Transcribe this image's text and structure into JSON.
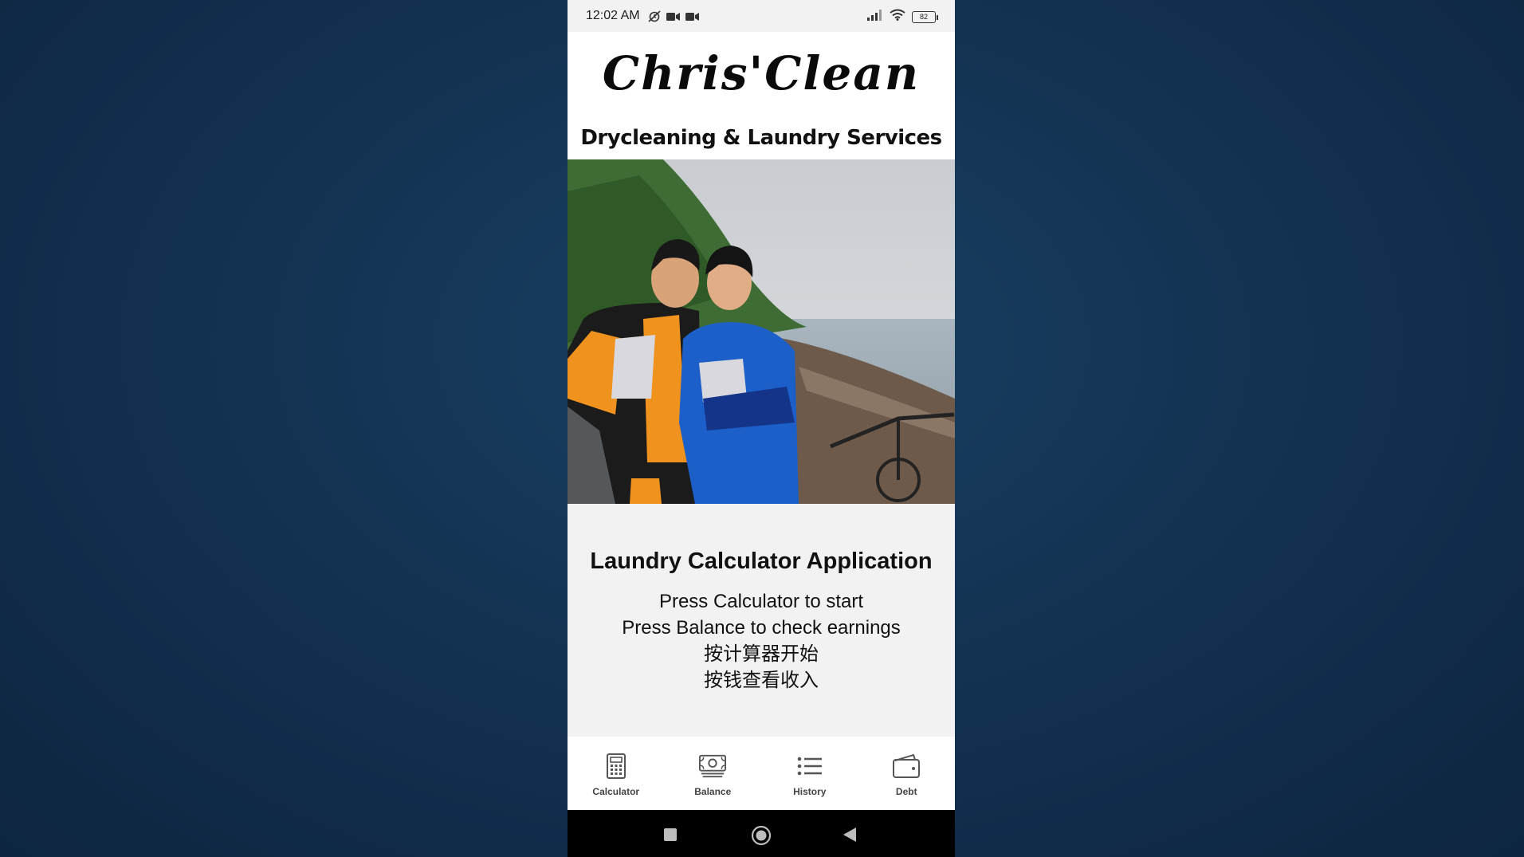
{
  "status_bar": {
    "time": "12:02 AM",
    "battery": "82",
    "icons": [
      "alarm-off-icon",
      "video-icon",
      "video-icon",
      "signal-icon",
      "wifi-icon",
      "battery-icon"
    ]
  },
  "logo": {
    "brand": "Chris'Clean",
    "tagline": "Drycleaning & Laundry Services"
  },
  "main": {
    "title": "Laundry Calculator Application",
    "lines": [
      "Press Calculator to start",
      "Press Balance to check earnings",
      "按计算器开始",
      "按钱查看收入"
    ]
  },
  "bottom_nav": {
    "items": [
      {
        "label": "Calculator",
        "icon": "calculator-icon"
      },
      {
        "label": "Balance",
        "icon": "money-icon"
      },
      {
        "label": "History",
        "icon": "list-icon"
      },
      {
        "label": "Debt",
        "icon": "wallet-icon"
      }
    ]
  },
  "system_nav": {
    "buttons": [
      "recents-button",
      "home-button",
      "back-button"
    ]
  },
  "colors": {
    "background": "#12304f",
    "app_bg": "#f2f2f2",
    "nav_bg": "#ffffff",
    "system_nav_bg": "#000000"
  }
}
